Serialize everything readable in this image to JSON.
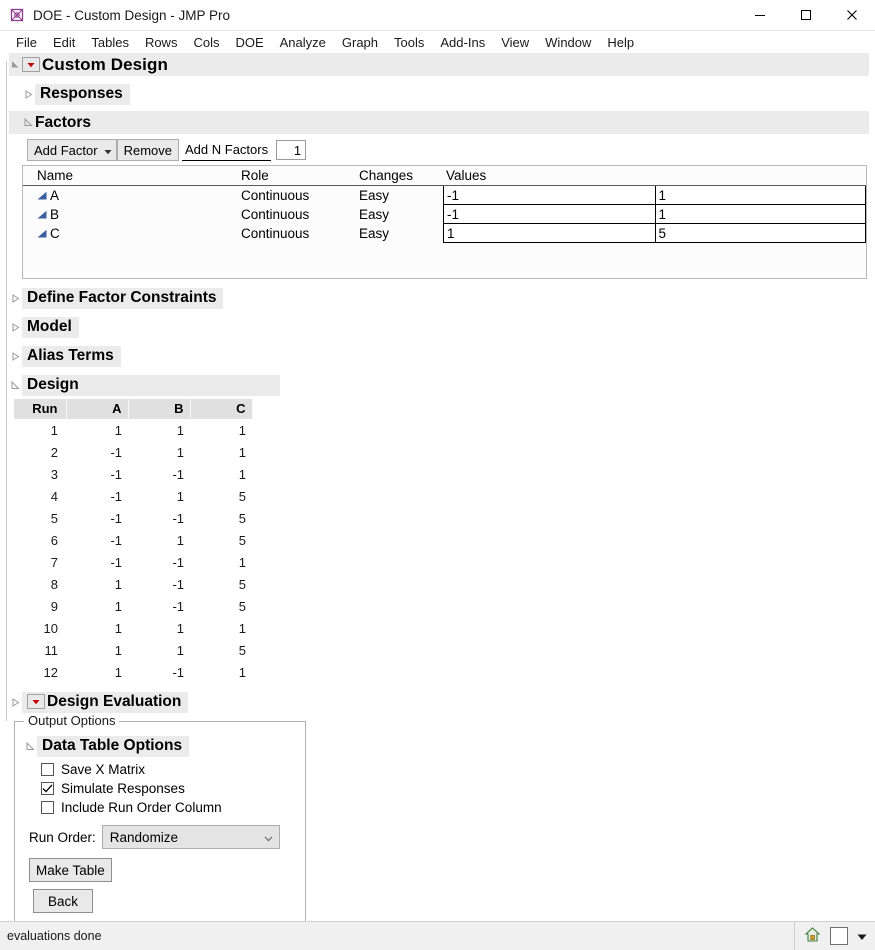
{
  "window": {
    "title": "DOE - Custom Design - JMP Pro",
    "app_icon": "jmp-icon",
    "minimize": "minimize-icon",
    "maximize": "maximize-icon",
    "close": "close-icon"
  },
  "menubar": {
    "items": [
      "File",
      "Edit",
      "Tables",
      "Rows",
      "Cols",
      "DOE",
      "Analyze",
      "Graph",
      "Tools",
      "Add-Ins",
      "View",
      "Window",
      "Help"
    ]
  },
  "report": {
    "title": "Custom Design",
    "sections": {
      "responses": "Responses",
      "factors": "Factors",
      "define_factor_constraints": "Define Factor Constraints",
      "model": "Model",
      "alias_terms": "Alias Terms",
      "design": "Design",
      "design_evaluation": "Design Evaluation"
    }
  },
  "factors_toolbar": {
    "add_factor": "Add Factor",
    "remove": "Remove",
    "add_n_factors": "Add N Factors",
    "n_value": "1"
  },
  "factors_table": {
    "headers": [
      "Name",
      "Role",
      "Changes",
      "Values"
    ],
    "rows": [
      {
        "name": "A",
        "role": "Continuous",
        "changes": "Easy",
        "low": "-1",
        "high": "1"
      },
      {
        "name": "B",
        "role": "Continuous",
        "changes": "Easy",
        "low": "-1",
        "high": "1"
      },
      {
        "name": "C",
        "role": "Continuous",
        "changes": "Easy",
        "low": "1",
        "high": "5"
      }
    ]
  },
  "design_table": {
    "headers": [
      "Run",
      "A",
      "B",
      "C"
    ],
    "rows": [
      [
        "1",
        "1",
        "1",
        "1"
      ],
      [
        "2",
        "-1",
        "1",
        "1"
      ],
      [
        "3",
        "-1",
        "-1",
        "1"
      ],
      [
        "4",
        "-1",
        "1",
        "5"
      ],
      [
        "5",
        "-1",
        "-1",
        "5"
      ],
      [
        "6",
        "-1",
        "1",
        "5"
      ],
      [
        "7",
        "-1",
        "-1",
        "1"
      ],
      [
        "8",
        "1",
        "-1",
        "5"
      ],
      [
        "9",
        "1",
        "-1",
        "5"
      ],
      [
        "10",
        "1",
        "1",
        "1"
      ],
      [
        "11",
        "1",
        "1",
        "5"
      ],
      [
        "12",
        "1",
        "-1",
        "1"
      ]
    ]
  },
  "output_options": {
    "legend": "Output Options",
    "data_table_options": "Data Table Options",
    "checkboxes": [
      {
        "label": "Save X Matrix",
        "checked": false
      },
      {
        "label": "Simulate Responses",
        "checked": true
      },
      {
        "label": "Include Run Order Column",
        "checked": false
      }
    ],
    "run_order_label": "Run Order:",
    "run_order_value": "Randomize",
    "make_table": "Make Table",
    "back": "Back"
  },
  "statusbar": {
    "message": "evaluations done",
    "home_icon": "home-lock-icon",
    "dropdown_icon": "caret-down-icon"
  },
  "colors": {
    "band": "#ebebeb",
    "header_gray": "#e0e0e0",
    "red_marker": "#c00000",
    "blue_triangle": "#3a5fa0",
    "button_face": "#e9e9e9"
  }
}
